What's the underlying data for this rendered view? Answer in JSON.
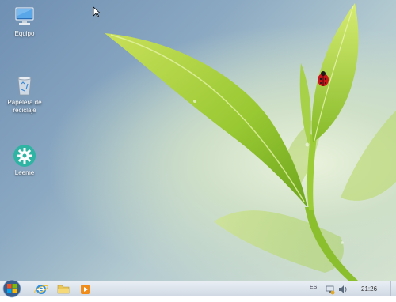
{
  "desktop": {
    "icons": [
      {
        "label": "Equipo",
        "icon": "computer-icon"
      },
      {
        "label": "Papelera de reciclaje",
        "icon": "recycle-bin-icon"
      },
      {
        "label": "Leeme",
        "icon": "gear-icon"
      }
    ]
  },
  "taskbar": {
    "pinned": [
      {
        "name": "Internet Explorer",
        "icon": "internet-explorer-icon"
      },
      {
        "name": "Explorador de archivos",
        "icon": "folder-icon"
      },
      {
        "name": "Reproductor multimedia",
        "icon": "media-player-icon"
      }
    ],
    "language": "ES",
    "clock": "21:26"
  }
}
